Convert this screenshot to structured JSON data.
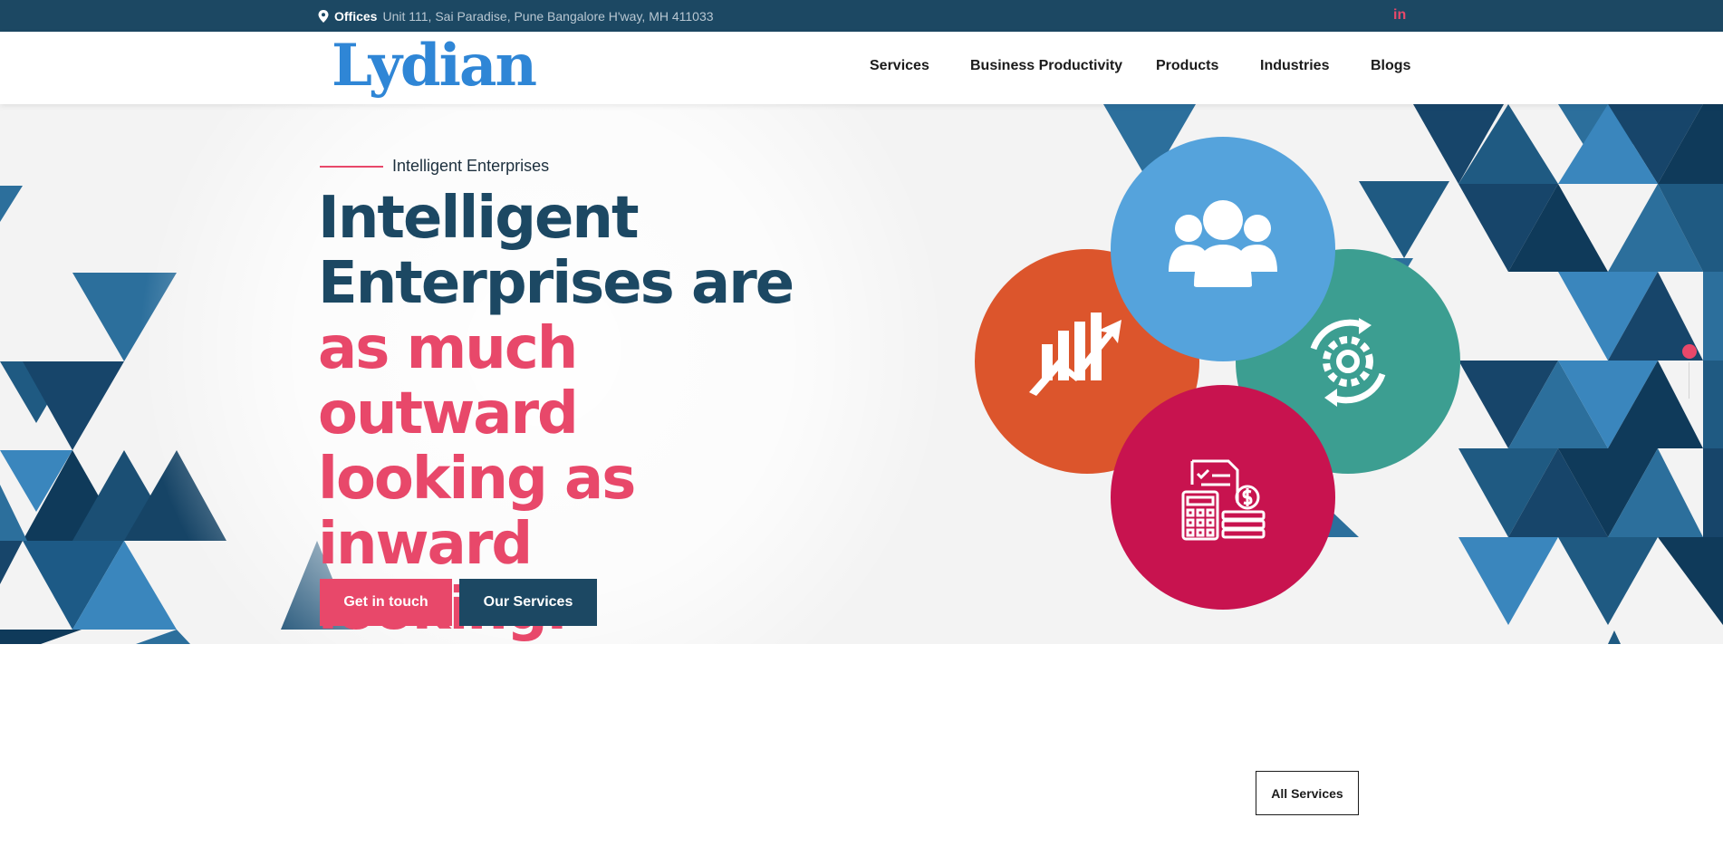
{
  "topbar": {
    "office_label": "Offices",
    "office_address": "Unit 111, Sai Paradise, Pune Bangalore H'way, MH 411033",
    "social": "in"
  },
  "header": {
    "logo": "Lydian",
    "nav": [
      "Services",
      "Business Productivity",
      "Products",
      "Industries",
      "Blogs"
    ]
  },
  "hero": {
    "eyebrow": "Intelligent Enterprises",
    "headline_dark": [
      "Intelligent",
      "Enterprises are"
    ],
    "headline_pink": [
      "as much outward",
      "looking as inward",
      "looking."
    ],
    "primary_button": "Get in touch",
    "secondary_button": "Our Services",
    "feature_icons": [
      "users-group-icon",
      "growth-chart-icon",
      "gear-refresh-icon",
      "calculator-invoice-icon"
    ]
  },
  "services": {
    "all_button": "All Services"
  },
  "colors": {
    "navy": "#1c4863",
    "pink": "#e8486a",
    "logo_blue": "#2f86d6",
    "circle_orange": "#dc552c",
    "circle_blue": "#55a3dc",
    "circle_teal": "#3c9e91",
    "circle_magenta": "#c8134f"
  }
}
